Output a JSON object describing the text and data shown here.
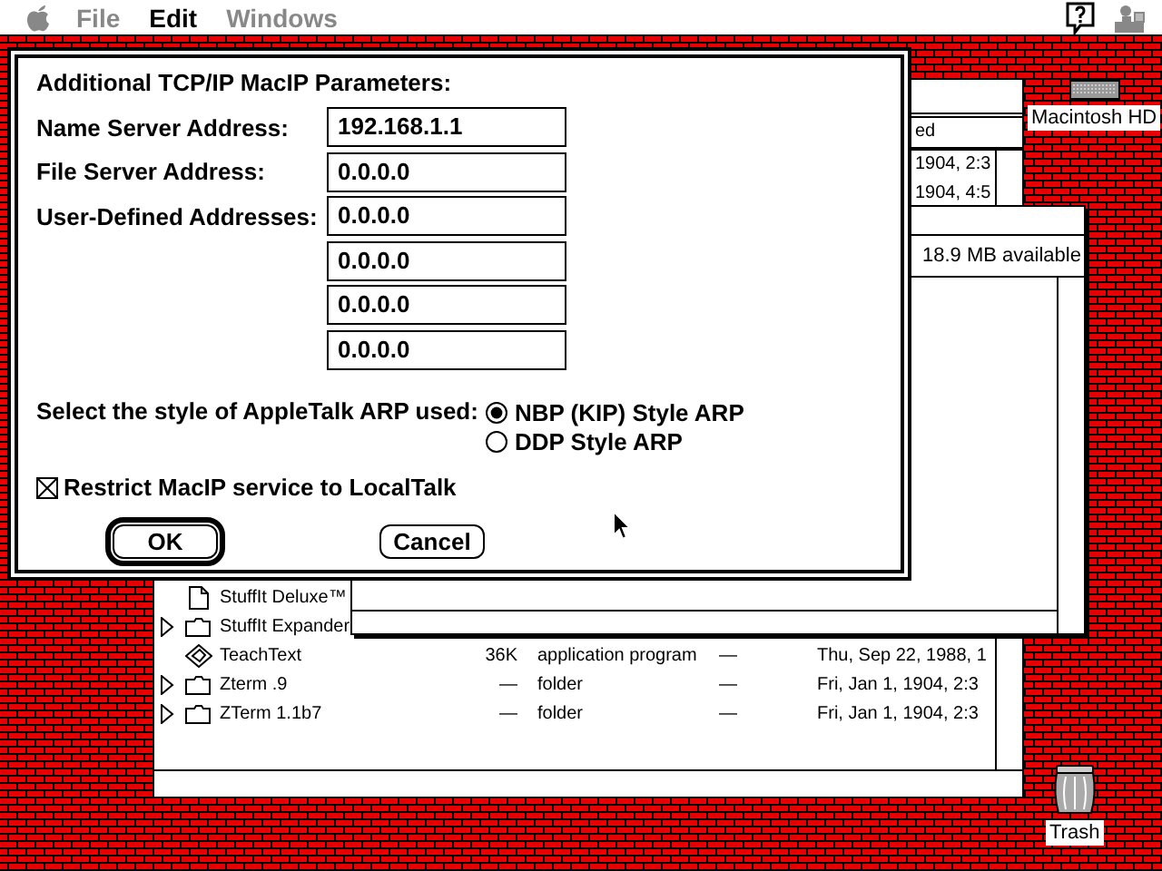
{
  "menu_bar": {
    "items": [
      {
        "label": "File",
        "disabled": true
      },
      {
        "label": "Edit",
        "disabled": false
      },
      {
        "label": "Windows",
        "disabled": true
      }
    ]
  },
  "finder_window": {
    "column_header": "ed",
    "top_rows": [
      "1904, 2:3",
      "1904, 4:5"
    ],
    "rows": [
      {
        "kind": "document",
        "name": "StuffIt Deluxe™"
      },
      {
        "kind": "folder",
        "name": "StuffIt Expander"
      },
      {
        "kind": "application",
        "name": "TeachText",
        "size": "36K",
        "type": "application program",
        "label": "—",
        "date": "Thu, Sep 22, 1988, 1"
      },
      {
        "kind": "folder",
        "name": "Zterm .9",
        "size": "—",
        "type": "folder",
        "label": "—",
        "date": "Fri, Jan 1, 1904, 2:3"
      },
      {
        "kind": "folder",
        "name": "ZTerm 1.1b7",
        "size": "—",
        "type": "folder",
        "label": "—",
        "date": "Fri, Jan 1, 1904, 2:3"
      }
    ]
  },
  "disk_window": {
    "info": "18.9 MB available"
  },
  "dialog": {
    "title": "Additional TCP/IP MacIP Parameters:",
    "fields": [
      {
        "label": "Name Server Address:",
        "values": [
          "192.168.1.1"
        ]
      },
      {
        "label": "File Server Address:",
        "values": [
          "0.0.0.0"
        ]
      },
      {
        "label": "User-Defined Addresses:",
        "values": [
          "0.0.0.0",
          "0.0.0.0",
          "0.0.0.0",
          "0.0.0.0"
        ]
      }
    ],
    "arp": {
      "label": "Select the style of AppleTalk ARP used:",
      "options": [
        {
          "label": "NBP (KIP) Style ARP",
          "selected": true
        },
        {
          "label": "DDP Style ARP",
          "selected": false
        }
      ]
    },
    "restrict": {
      "label": "Restrict MacIP service to LocalTalk",
      "checked": true
    },
    "buttons": [
      {
        "label": "OK",
        "default": true
      },
      {
        "label": "Cancel",
        "default": false
      }
    ]
  },
  "desktop_icons": [
    {
      "kind": "disk",
      "label": "Macintosh HD"
    },
    {
      "kind": "trash",
      "label": "Trash"
    }
  ]
}
